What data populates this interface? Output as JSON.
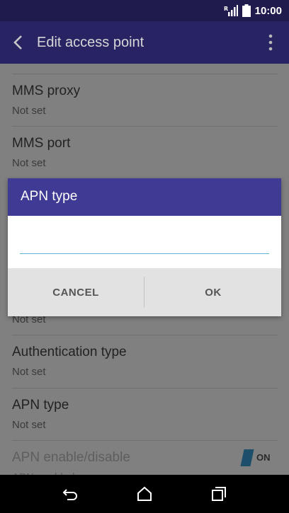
{
  "status_bar": {
    "time": "10:00",
    "signal_icon": "signal-icon",
    "battery_icon": "battery-icon"
  },
  "app_bar": {
    "title": "Edit access point",
    "back_icon": "back-arrow-icon",
    "menu_icon": "overflow-menu-icon"
  },
  "settings": [
    {
      "title": "MMS proxy",
      "value": "Not set"
    },
    {
      "title": "MMS port",
      "value": "Not set"
    },
    {
      "title": "",
      "value": "Not set"
    },
    {
      "title": "Authentication type",
      "value": "Not set"
    },
    {
      "title": "APN type",
      "value": "Not set"
    },
    {
      "title": "APN enable/disable",
      "value": "APN enabled",
      "toggle": "ON"
    }
  ],
  "dialog": {
    "title": "APN type",
    "input_value": "",
    "cancel_label": "CANCEL",
    "ok_label": "OK"
  },
  "nav_bar": {
    "back_icon": "nav-back-icon",
    "home_icon": "nav-home-icon",
    "recents_icon": "nav-recents-icon"
  }
}
